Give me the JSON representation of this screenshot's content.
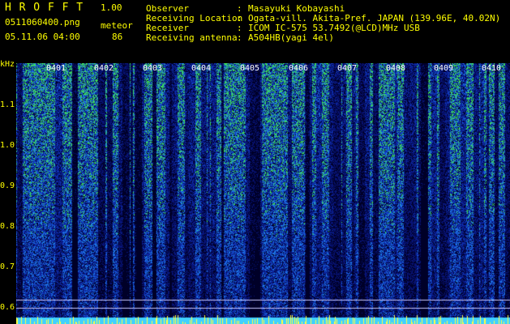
{
  "header": {
    "app_title": "H R O F F T",
    "app_version": "1.00",
    "filename": "0511060400.png",
    "mode_label": "meteor",
    "datetime": "05.11.06 04:00",
    "count": "86"
  },
  "info": {
    "labels": [
      "Observer",
      "Receiving Location",
      "Receiver",
      "Receiving antenna"
    ],
    "colons": [
      ":",
      ":",
      ":",
      ":"
    ],
    "values": [
      "Masayuki Kobayashi",
      "Ogata-vill. Akita-Pref. JAPAN (139.96E, 40.02N)",
      "ICOM IC-575 53.7492(@LCD)MHz USB",
      "A504HB(yagi 4el)"
    ]
  },
  "axis": {
    "unit": "kHz",
    "ticks": [
      "1.1",
      "1.0",
      "0.9",
      "0.8",
      "0.7",
      "0.6"
    ],
    "time_labels": [
      "0401",
      "0402",
      "0403",
      "0404",
      "0405",
      "0406",
      "0407",
      "0408",
      "0409",
      "0410"
    ]
  },
  "colors": {
    "background": "#000000",
    "header_accent": "#ffff00",
    "noise_low": "#0a1a8a",
    "noise_mid": "#1f5fd0",
    "noise_high": "#40e060",
    "bottom_band": "#40d0ff"
  }
}
